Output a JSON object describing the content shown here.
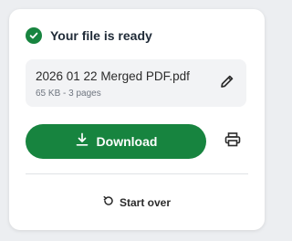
{
  "status": {
    "title": "Your file is ready",
    "icon": "check-circle-icon",
    "color": "#17843f"
  },
  "file": {
    "name": "2026 01 22 Merged PDF.pdf",
    "meta": "65 KB - 3 pages",
    "edit_icon": "pencil-icon"
  },
  "actions": {
    "download_label": "Download",
    "download_icon": "download-icon",
    "print_icon": "printer-icon",
    "start_over_label": "Start over",
    "start_over_icon": "restart-icon",
    "accent": "#17843f"
  }
}
